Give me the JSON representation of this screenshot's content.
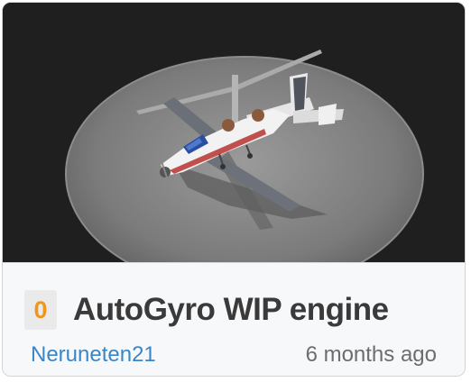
{
  "card": {
    "score": "0",
    "title": "AutoGyro WIP engine",
    "author": "Neruneten21",
    "time_ago": "6 months ago"
  },
  "thumbnail": {
    "content": "autogyro-aircraft-render"
  },
  "colors": {
    "score_text": "#f0961d",
    "author_link": "#3a86c8",
    "title_text": "#3a3a3a",
    "time_text": "#6d6d6d",
    "thumb_background": "#1f1f1f"
  }
}
